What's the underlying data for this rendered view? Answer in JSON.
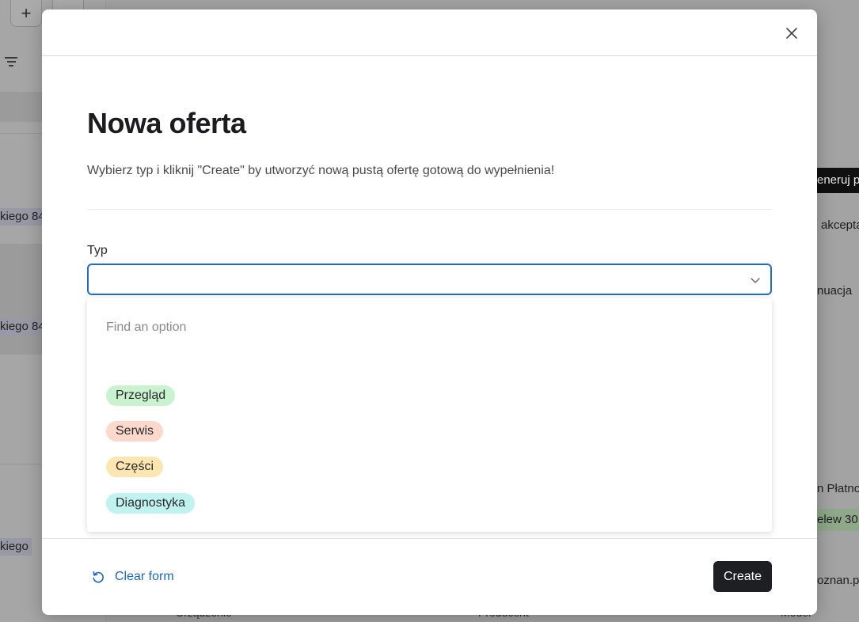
{
  "background": {
    "left_chips": [
      "kiego 84",
      "kiego 84",
      "kiego"
    ],
    "right_dark_button": "eneruj p",
    "right_texts": [
      "akcepta",
      "nuacja",
      "n Płatnos",
      "oznan.pl"
    ],
    "right_green_chip": "elew 30",
    "bottom_texts": [
      "Urządzenie",
      "Producent",
      "Model"
    ]
  },
  "modal": {
    "title": "Nowa oferta",
    "subtitle": "Wybierz typ i kliknij \"Create\" by utworzyć nową pustą ofertę gotową do wypełnienia!",
    "field_label": "Typ",
    "select_value": "",
    "search_placeholder": "Find an option",
    "options": [
      {
        "label": "Przegląd",
        "color": "#c9f2cf"
      },
      {
        "label": "Serwis",
        "color": "#fcd9cc"
      },
      {
        "label": "Części",
        "color": "#fde6b1"
      },
      {
        "label": "Diagnostyka",
        "color": "#c0f2ef"
      }
    ],
    "clear_label": "Clear form",
    "create_label": "Create"
  },
  "colors": {
    "accent_blue": "#1f6bd1",
    "primary_button": "#1e1f22"
  },
  "icons": {
    "close": "close-icon",
    "chevron": "chevron-down-icon",
    "clear": "reset-icon",
    "add": "plus-icon",
    "filter": "filter-icon"
  }
}
